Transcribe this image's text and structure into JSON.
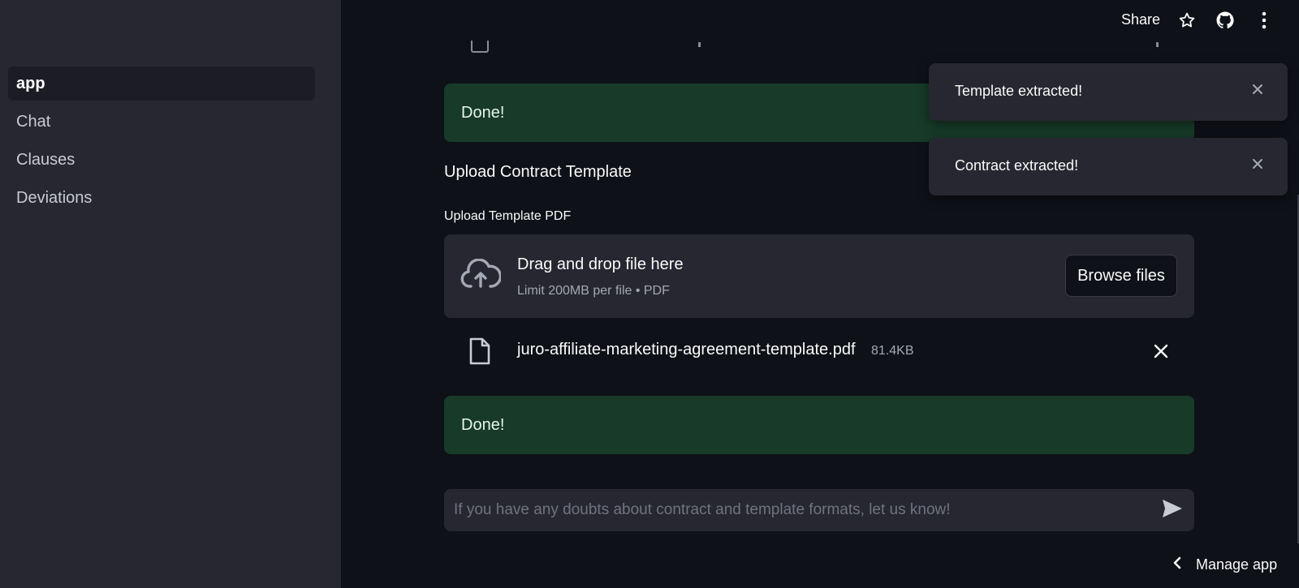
{
  "sidebar": {
    "items": [
      {
        "label": "app",
        "active": true
      },
      {
        "label": "Chat",
        "active": false
      },
      {
        "label": "Clauses",
        "active": false
      },
      {
        "label": "Deviations",
        "active": false
      }
    ]
  },
  "topbar": {
    "share_label": "Share",
    "icons": [
      "star-icon",
      "github-icon",
      "more-vertical-icon"
    ]
  },
  "main": {
    "success_top": "Done!",
    "section_title": "Upload Contract Template",
    "uploader": {
      "label": "Upload Template PDF",
      "title": "Drag and drop file here",
      "subtitle": "Limit 200MB per file • PDF",
      "browse_label": "Browse files",
      "icon": "cloud-upload-icon"
    },
    "file": {
      "name": "juro-affiliate-marketing-agreement-template.pdf",
      "size": "81.4KB",
      "icon": "file-icon"
    },
    "success_bottom": "Done!"
  },
  "chat": {
    "placeholder": "If you have any doubts about contract and template formats, let us know!",
    "value": ""
  },
  "footer": {
    "manage_label": "Manage app"
  },
  "toasts": [
    {
      "text": "Template extracted!"
    },
    {
      "text": "Contract extracted!"
    }
  ],
  "colors": {
    "background": "#0e1117",
    "sidebar": "#262730",
    "success": "#173b28",
    "text": "#fafafa"
  }
}
